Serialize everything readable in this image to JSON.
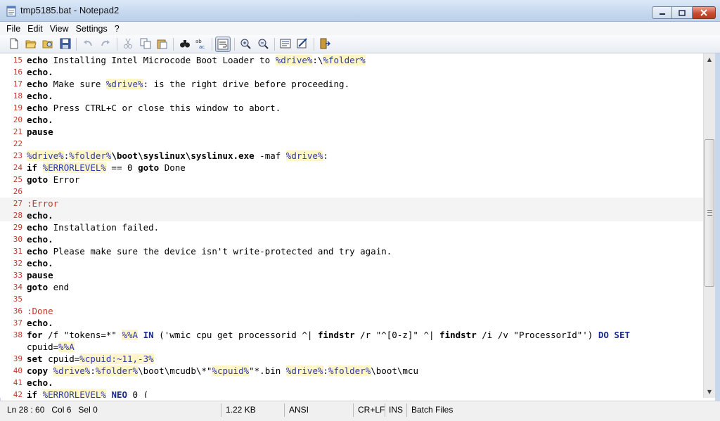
{
  "window": {
    "title": "tmp5185.bat - Notepad2"
  },
  "menu": [
    "File",
    "Edit",
    "View",
    "Settings",
    "?"
  ],
  "toolbar": {
    "icons": [
      "new-file-icon",
      "open-file-icon",
      "browse-icon",
      "save-icon",
      "undo-icon",
      "redo-icon",
      "cut-icon",
      "copy-icon",
      "paste-icon",
      "find-icon",
      "replace-icon",
      "word-wrap-icon",
      "zoom-in-icon",
      "zoom-out-icon",
      "schemes-icon",
      "customize-icon",
      "exit-icon"
    ]
  },
  "editor": {
    "current_line": 28,
    "lines": [
      {
        "n": "15",
        "segs": [
          [
            "kw",
            "echo"
          ],
          [
            "t",
            " Installing Intel Microcode Boot Loader to "
          ],
          [
            "var",
            "%drive%"
          ],
          [
            "t",
            ":\\"
          ],
          [
            "var",
            "%folder%"
          ]
        ]
      },
      {
        "n": "16",
        "segs": [
          [
            "kw",
            "echo."
          ]
        ]
      },
      {
        "n": "17",
        "segs": [
          [
            "kw",
            "echo"
          ],
          [
            "t",
            " Make sure "
          ],
          [
            "var",
            "%drive%"
          ],
          [
            "t",
            ": is the right drive before proceeding."
          ]
        ]
      },
      {
        "n": "18",
        "segs": [
          [
            "kw",
            "echo."
          ]
        ]
      },
      {
        "n": "19",
        "segs": [
          [
            "kw",
            "echo"
          ],
          [
            "t",
            " Press CTRL+C or close this window to abort."
          ]
        ]
      },
      {
        "n": "20",
        "segs": [
          [
            "kw",
            "echo."
          ]
        ]
      },
      {
        "n": "21",
        "segs": [
          [
            "kw",
            "pause"
          ]
        ]
      },
      {
        "n": "22",
        "segs": []
      },
      {
        "n": "23",
        "segs": [
          [
            "var",
            "%drive%"
          ],
          [
            "t",
            ":"
          ],
          [
            "var",
            "%folder%"
          ],
          [
            "kw",
            "\\boot\\syslinux\\syslinux.exe"
          ],
          [
            "t",
            " -maf "
          ],
          [
            "var",
            "%drive%"
          ],
          [
            "t",
            ":"
          ]
        ]
      },
      {
        "n": "24",
        "segs": [
          [
            "kw",
            "if"
          ],
          [
            "t",
            " "
          ],
          [
            "var",
            "%ERRORLEVEL%"
          ],
          [
            "t",
            " == 0 "
          ],
          [
            "kw",
            "goto"
          ],
          [
            "t",
            " Done"
          ]
        ]
      },
      {
        "n": "25",
        "segs": [
          [
            "kw",
            "goto"
          ],
          [
            "t",
            " Error"
          ]
        ]
      },
      {
        "n": "26",
        "segs": []
      },
      {
        "n": "27",
        "segs": [
          [
            "lbl",
            ":Error"
          ]
        ]
      },
      {
        "n": "28",
        "segs": [
          [
            "kw",
            "echo."
          ]
        ]
      },
      {
        "n": "29",
        "segs": [
          [
            "kw",
            "echo"
          ],
          [
            "t",
            " Installation failed."
          ]
        ]
      },
      {
        "n": "30",
        "segs": [
          [
            "kw",
            "echo."
          ]
        ]
      },
      {
        "n": "31",
        "segs": [
          [
            "kw",
            "echo"
          ],
          [
            "t",
            " Please make sure the device isn't write-protected and try again."
          ]
        ]
      },
      {
        "n": "32",
        "segs": [
          [
            "kw",
            "echo."
          ]
        ]
      },
      {
        "n": "33",
        "segs": [
          [
            "kw",
            "pause"
          ]
        ]
      },
      {
        "n": "34",
        "segs": [
          [
            "kw",
            "goto"
          ],
          [
            "t",
            " end"
          ]
        ]
      },
      {
        "n": "35",
        "segs": []
      },
      {
        "n": "36",
        "segs": [
          [
            "lbl",
            ":Done"
          ]
        ]
      },
      {
        "n": "37",
        "segs": [
          [
            "kw",
            "echo."
          ]
        ]
      },
      {
        "n": "38",
        "segs": [
          [
            "kw",
            "for"
          ],
          [
            "t",
            " /f \"tokens=*\" "
          ],
          [
            "var",
            "%%A"
          ],
          [
            "t",
            " "
          ],
          [
            "kw2",
            "IN"
          ],
          [
            "t",
            " ('wmic cpu get processorid ^| "
          ],
          [
            "kw",
            "findstr"
          ],
          [
            "t",
            " /r \"^[0-z]\" ^| "
          ],
          [
            "kw",
            "findstr"
          ],
          [
            "t",
            " /i /v \"ProcessorId\"') "
          ],
          [
            "kw2",
            "DO"
          ],
          [
            "t",
            " "
          ],
          [
            "kw2",
            "SET"
          ]
        ]
      },
      {
        "n": "",
        "segs": [
          [
            "t",
            "cpuid="
          ],
          [
            "var",
            "%%A"
          ]
        ]
      },
      {
        "n": "39",
        "segs": [
          [
            "kw",
            "set"
          ],
          [
            "t",
            " cpuid="
          ],
          [
            "var",
            "%cpuid:~11,-3%"
          ]
        ]
      },
      {
        "n": "40",
        "segs": [
          [
            "kw",
            "copy"
          ],
          [
            "t",
            " "
          ],
          [
            "var",
            "%drive%"
          ],
          [
            "t",
            ":"
          ],
          [
            "var",
            "%folder%"
          ],
          [
            "t",
            "\\boot\\mcudb\\*\""
          ],
          [
            "var",
            "%cpuid%"
          ],
          [
            "t",
            "\"*.bin "
          ],
          [
            "var",
            "%drive%"
          ],
          [
            "t",
            ":"
          ],
          [
            "var",
            "%folder%"
          ],
          [
            "t",
            "\\boot\\mcu"
          ]
        ]
      },
      {
        "n": "41",
        "segs": [
          [
            "kw",
            "echo."
          ]
        ]
      },
      {
        "n": "42",
        "segs": [
          [
            "kw",
            "if"
          ],
          [
            "t",
            " "
          ],
          [
            "var",
            "%ERRORLEVEL%"
          ],
          [
            "t",
            " "
          ],
          [
            "kw2",
            "NEQ"
          ],
          [
            "t",
            " 0 ("
          ]
        ]
      }
    ]
  },
  "status": {
    "position": "Ln 28 : 60   Col 6   Sel 0",
    "size": "1.22 KB",
    "encoding": "ANSI",
    "eol": "CR+LF",
    "mode": "INS",
    "scheme": "Batch Files"
  }
}
